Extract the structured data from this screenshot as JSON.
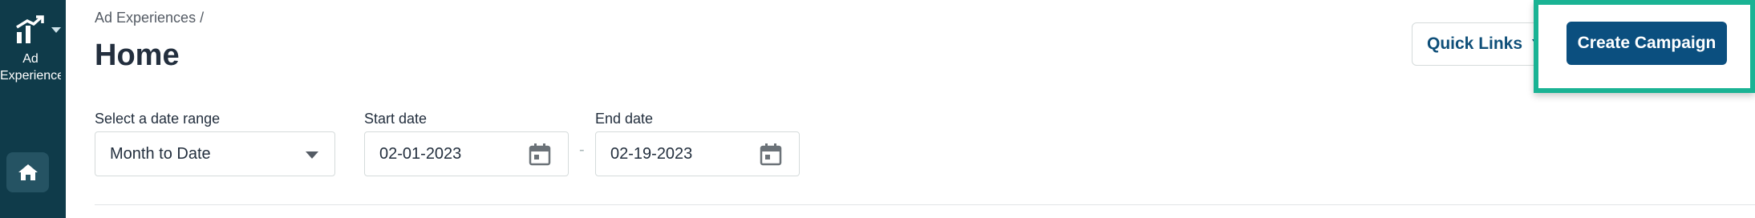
{
  "nav": {
    "app_label_line1": "Ad",
    "app_label_line2": "Experiences",
    "logo_icon": "growth-chart-icon",
    "home_icon": "home-icon"
  },
  "header": {
    "breadcrumb": "Ad Experiences",
    "breadcrumb_separator": "/",
    "title": "Home",
    "quick_links_label": "Quick Links",
    "create_campaign_label": "Create Campaign"
  },
  "filters": {
    "date_range_label": "Select a date range",
    "date_range_value": "Month to Date",
    "start_date_label": "Start date",
    "start_date_value": "02-01-2023",
    "range_separator": "-",
    "end_date_label": "End date",
    "end_date_value": "02-19-2023"
  },
  "colors": {
    "nav_bg": "#0f3b4a",
    "primary": "#0b4f7f",
    "highlight": "#1ab394"
  }
}
